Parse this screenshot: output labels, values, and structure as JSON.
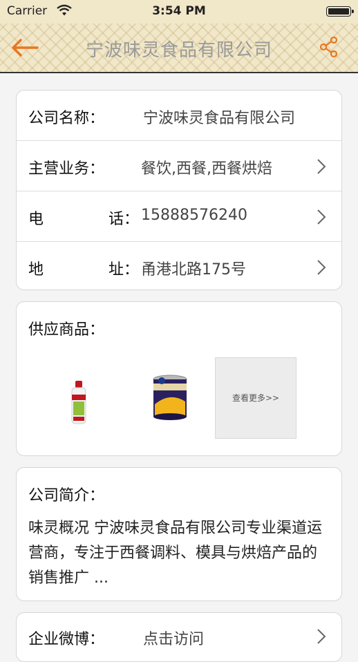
{
  "status_bar": {
    "carrier": "Carrier",
    "time": "3:54 PM"
  },
  "nav": {
    "title": "宁波味灵食品有限公司",
    "back_icon": "arrow-left-icon",
    "share_icon": "share-icon",
    "accent": "#e8771f"
  },
  "info": {
    "company_label": "公司名称：",
    "company_value": "宁波味灵食品有限公司",
    "business_label": "主营业务：",
    "business_value": "餐饮,西餐,西餐烘焙",
    "phone_label": "电",
    "phone_label2": "话：",
    "phone_value": "15888576240",
    "address_label": "地",
    "address_label2": "址：",
    "address_value": "甬港北路175号"
  },
  "products": {
    "title": "供应商品：",
    "more_label": "查看更多>>"
  },
  "intro": {
    "title": "公司简介：",
    "text": "味灵概况 宁波味灵食品有限公司专业渠道运营商，专注于西餐调料、模具与烘焙产品的销售推广 ..."
  },
  "bottom_row": {
    "label": "企业微博：",
    "value": "点击访问"
  }
}
